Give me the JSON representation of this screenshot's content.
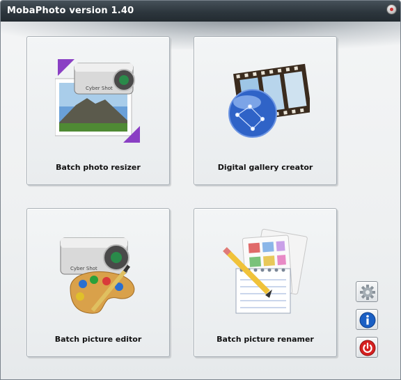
{
  "window": {
    "title": "MobaPhoto version 1.40"
  },
  "tiles": [
    {
      "label": "Batch photo resizer"
    },
    {
      "label": "Digital gallery creator"
    },
    {
      "label": "Batch picture editor"
    },
    {
      "label": "Batch picture renamer"
    }
  ],
  "side_buttons": [
    {
      "icon": "gear-icon"
    },
    {
      "icon": "info-icon"
    },
    {
      "icon": "power-icon"
    }
  ],
  "colors": {
    "titlebar": "#2d363d",
    "title_text": "#ffffff",
    "info_blue": "#1a5fc4",
    "power_red": "#d62020"
  }
}
